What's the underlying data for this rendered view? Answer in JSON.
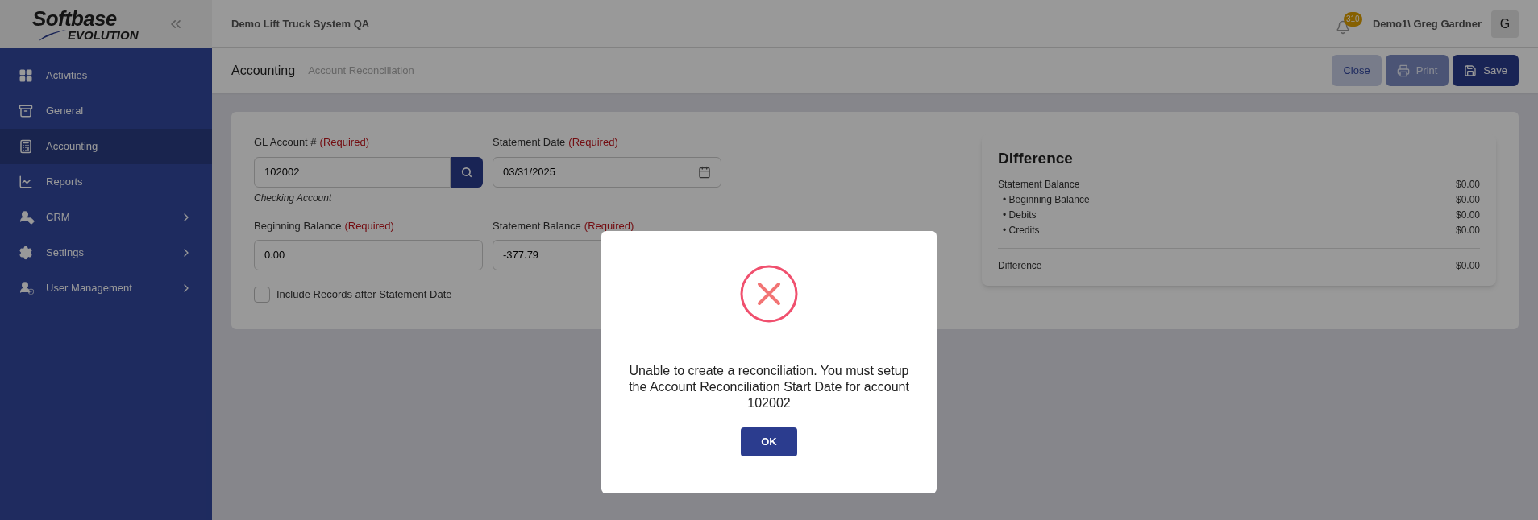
{
  "logo": {
    "line_1": "Softbase",
    "line_2": "EVOLUTION"
  },
  "header": {
    "title": "Demo Lift Truck System QA",
    "notifications": "310",
    "user": "Demo1\\ Greg Gardner",
    "avatar": "G"
  },
  "sidebar": {
    "items": [
      {
        "label": "Activities",
        "selected": false,
        "submenu": false
      },
      {
        "label": "General",
        "selected": false,
        "submenu": false
      },
      {
        "label": "Accounting",
        "selected": true,
        "submenu": false
      },
      {
        "label": "Reports",
        "selected": false,
        "submenu": false
      },
      {
        "label": "CRM",
        "selected": false,
        "submenu": true
      },
      {
        "label": "Settings",
        "selected": false,
        "submenu": true
      },
      {
        "label": "User Management",
        "selected": false,
        "submenu": true
      }
    ]
  },
  "breadcrumb": [
    "Accounting",
    "Account Reconciliation"
  ],
  "actions": [
    {
      "label": "Close",
      "kind": "light"
    },
    {
      "label": "Print",
      "kind": "muted"
    },
    {
      "label": "Save",
      "kind": "primary"
    }
  ],
  "form": {
    "fields": [
      {
        "label": "GL Account #",
        "required": "(Required)",
        "value": "102002",
        "kind": "lookup",
        "hint": "Checking Account"
      },
      {
        "label": "Statement Date",
        "required": "(Required)",
        "value": "03/31/2025",
        "kind": "date"
      },
      {
        "label": "Beginning Balance",
        "required": "(Required)",
        "value": "0.00",
        "kind": "text"
      },
      {
        "label": "Statement Balance",
        "required": "(Required)",
        "value": "-377.79",
        "kind": "text"
      }
    ],
    "checkbox": {
      "label": "Include Records after Statement Date",
      "checked": false
    }
  },
  "difference": {
    "title": "Difference",
    "rows": [
      {
        "label": "Statement Balance",
        "value": "$0.00",
        "kind": "main"
      },
      {
        "label": "• Beginning Balance",
        "value": "$0.00",
        "kind": "sub"
      },
      {
        "label": "• Debits",
        "value": "$0.00",
        "kind": "sub"
      },
      {
        "label": "• Credits",
        "value": "$0.00",
        "kind": "sub"
      }
    ],
    "total": {
      "label": "Difference",
      "value": "$0.00"
    }
  },
  "dialog": {
    "kind": "error",
    "message": "Unable to create a reconciliation. You must setup the Account Reconciliation Start Date for account 102002",
    "button": "OK"
  }
}
